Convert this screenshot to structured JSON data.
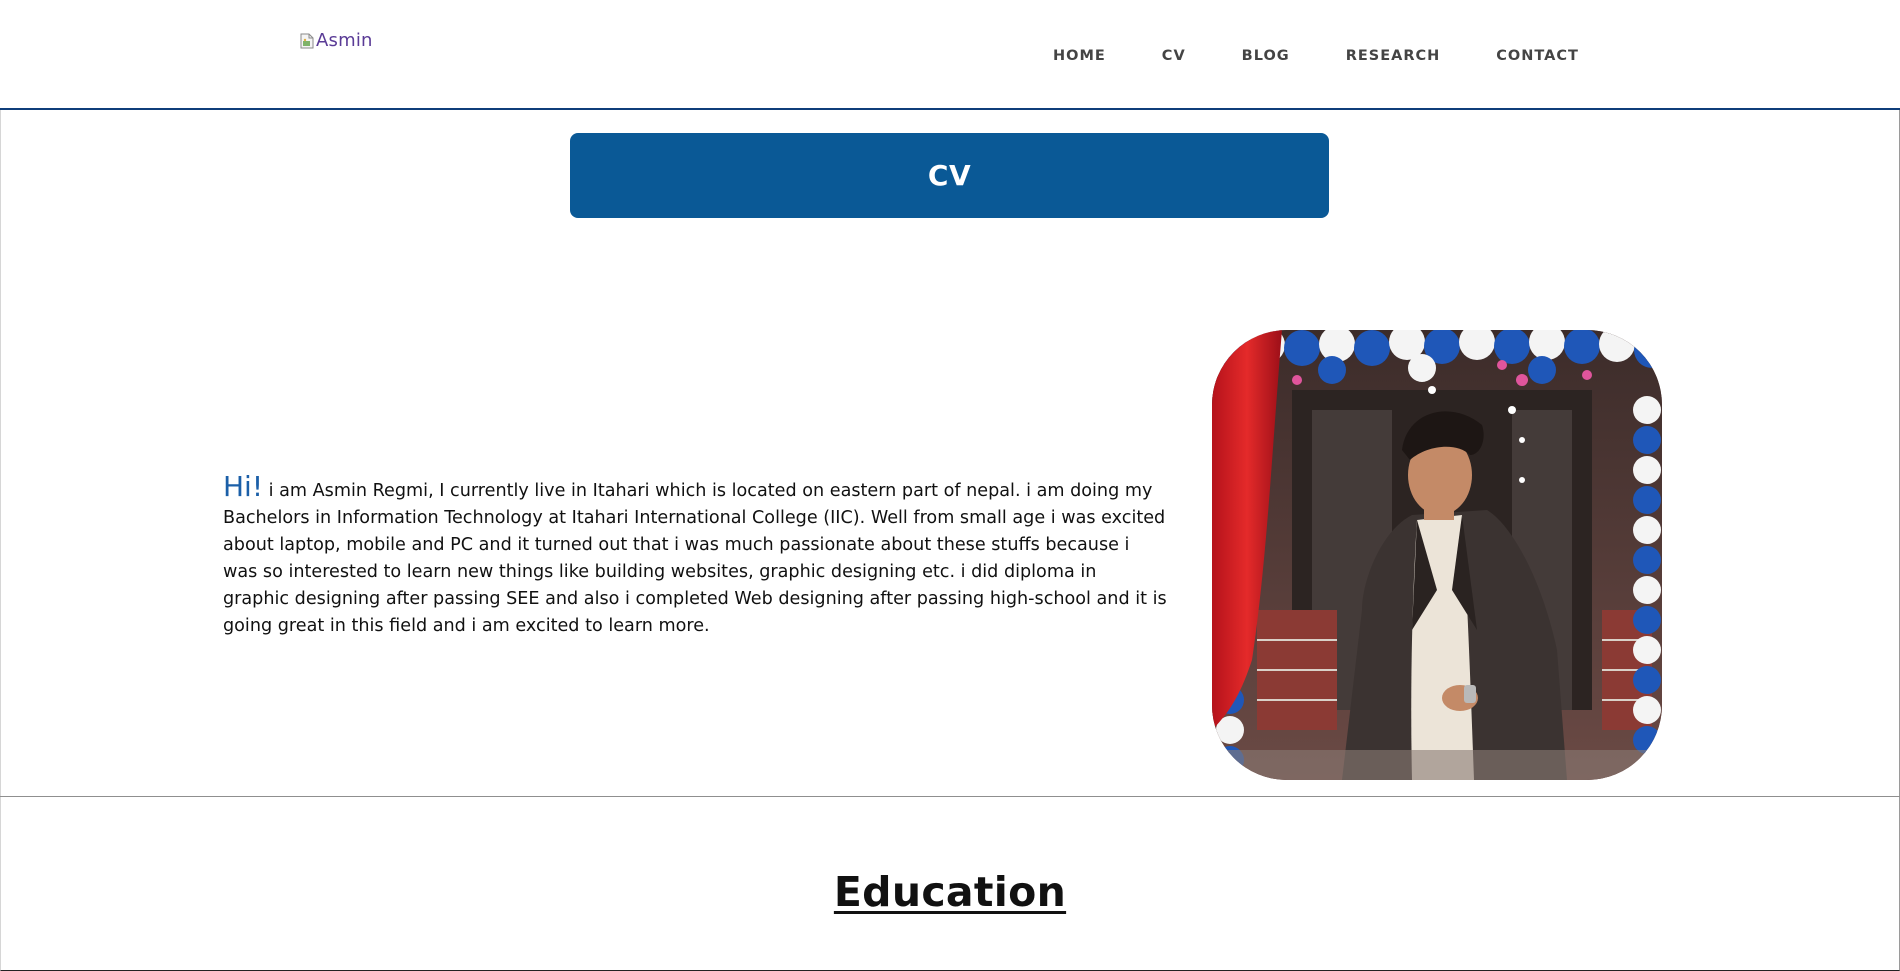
{
  "header": {
    "logo_alt": "Asmin",
    "nav": [
      {
        "label": "HOME"
      },
      {
        "label": "CV"
      },
      {
        "label": "BLOG"
      },
      {
        "label": "RESEARCH"
      },
      {
        "label": "CONTACT"
      }
    ]
  },
  "banner": {
    "title": "CV"
  },
  "intro": {
    "greeting": "Hi!",
    "text": "i am Asmin Regmi, I currently live in Itahari which is located on eastern part of nepal. i am doing my Bachelors in Information Technology at Itahari International College (IIC). Well from small age i was excited about laptop, mobile and PC and it turned out that i was much passionate about these stuffs because i was so interested to learn new things like building websites, graphic designing etc. i did diploma in graphic designing after passing SEE and also i completed Web designing after passing high-school and it is going great in this field and i am excited to learn more."
  },
  "education": {
    "title": "Education"
  },
  "colors": {
    "banner": "#0a5996",
    "header_rule": "#0f3d7a",
    "greeting": "#1b5fa8",
    "logo_alt": "#5a3b96"
  },
  "icons": [
    "broken-image-icon"
  ]
}
